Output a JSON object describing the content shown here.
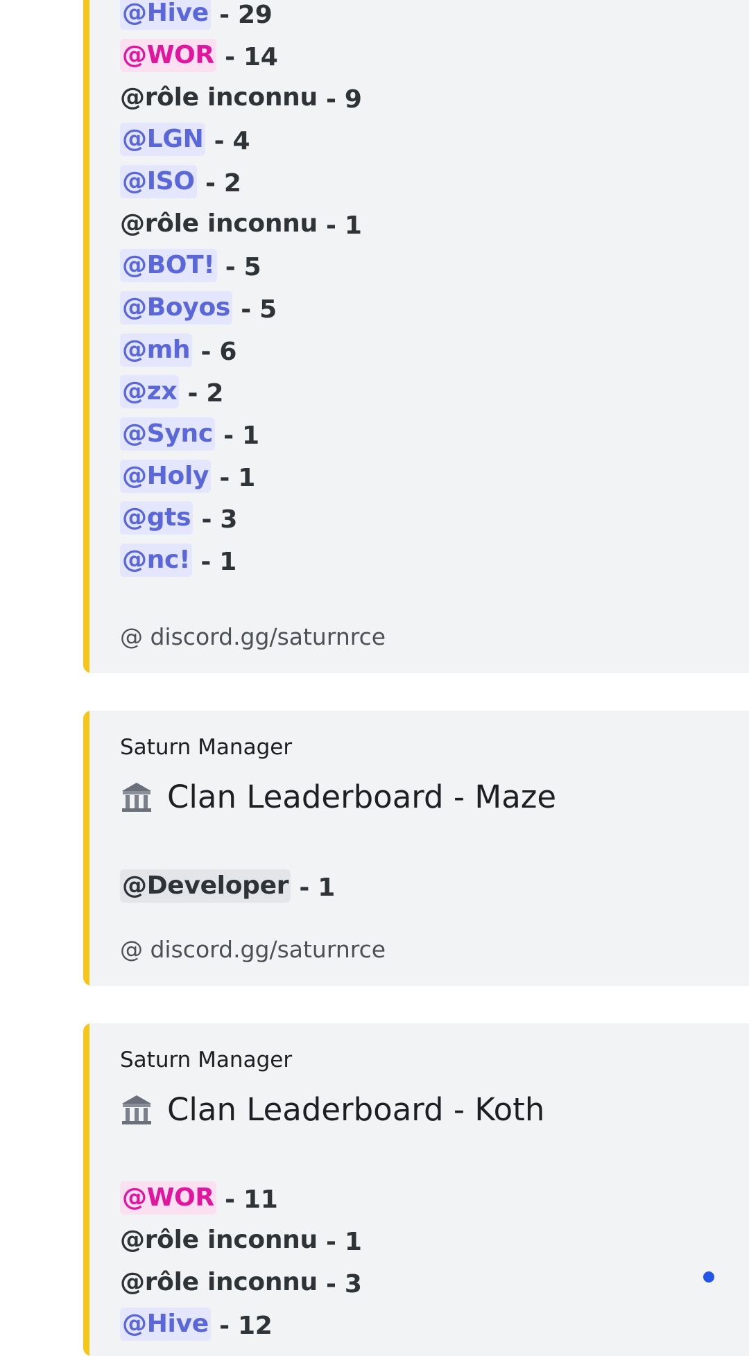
{
  "embed_1": {
    "rows": [
      {
        "mention": "@Hive",
        "style": "blue",
        "value": " - 29"
      },
      {
        "mention": "@WOR",
        "style": "pink",
        "value": " - 14"
      },
      {
        "mention": "@rôle inconnu",
        "style": "plain",
        "value": " - 9"
      },
      {
        "mention": "@LGN",
        "style": "blue",
        "value": " - 4"
      },
      {
        "mention": "@ISO",
        "style": "blue",
        "value": " - 2"
      },
      {
        "mention": "@rôle inconnu",
        "style": "plain",
        "value": " - 1"
      },
      {
        "mention": "@BOT!",
        "style": "blue",
        "value": " - 5"
      },
      {
        "mention": "@Boyos",
        "style": "blue",
        "value": " - 5"
      },
      {
        "mention": "@mh",
        "style": "blue",
        "value": " - 6"
      },
      {
        "mention": "@zx",
        "style": "blue",
        "value": " - 2"
      },
      {
        "mention": "@Sync",
        "style": "blue",
        "value": " - 1"
      },
      {
        "mention": "@Holy",
        "style": "blue",
        "value": " - 1"
      },
      {
        "mention": "@gts",
        "style": "blue",
        "value": " - 3"
      },
      {
        "mention": "@nc!",
        "style": "blue",
        "value": " - 1"
      }
    ],
    "footer": "@ discord.gg/saturnrce"
  },
  "embed_2": {
    "author": "Saturn Manager",
    "title": "Clan Leaderboard - Maze",
    "icon": "classical-building-icon",
    "rows": [
      {
        "mention": "@Developer",
        "style": "gray",
        "value": " - 1"
      }
    ],
    "footer": "@ discord.gg/saturnrce"
  },
  "embed_3": {
    "author": "Saturn Manager",
    "title": "Clan Leaderboard - Koth",
    "icon": "classical-building-icon",
    "rows": [
      {
        "mention": "@WOR",
        "style": "pink",
        "value": " - 11"
      },
      {
        "mention": "@rôle inconnu",
        "style": "plain",
        "value": " - 1"
      },
      {
        "mention": "@rôle inconnu",
        "style": "plain",
        "value": " - 3"
      },
      {
        "mention": "@Hive",
        "style": "blue",
        "value": " - 12"
      }
    ]
  },
  "colors": {
    "embed_accent": "#f5c518",
    "embed_background": "#f2f3f5",
    "mention_blue": "#5a67d8",
    "mention_pink": "#e0169f",
    "indicator_dot": "#2255e8"
  }
}
